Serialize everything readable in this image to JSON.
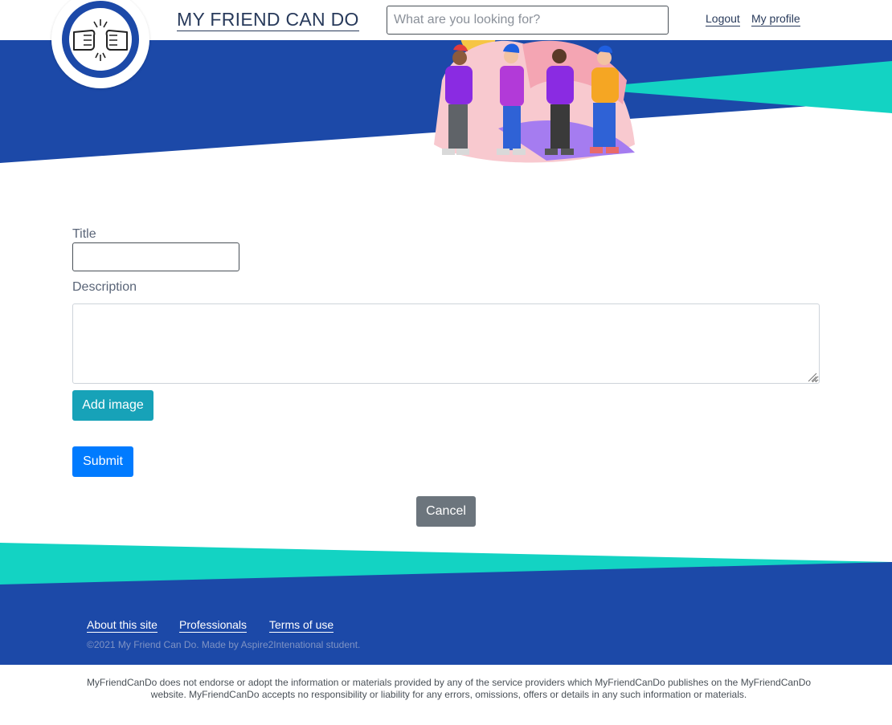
{
  "header": {
    "brand": "MY FRIEND CAN DO",
    "search_placeholder": "What are you looking for?",
    "nav": {
      "logout": "Logout",
      "profile": "My profile"
    }
  },
  "form": {
    "title_label": "Title",
    "title_value": "",
    "description_label": "Description",
    "description_value": "",
    "add_image_label": "Add image",
    "submit_label": "Submit",
    "cancel_label": "Cancel"
  },
  "footer": {
    "links": [
      "About this site",
      "Professionals",
      "Terms of use"
    ],
    "copyright": "©2021 My Friend Can Do. Made by Aspire2Intenational student.",
    "disclaimer": "MyFriendCanDo does not endorse or adopt the information or materials provided by any of the service providers which MyFriendCanDo publishes on the MyFriendCanDo website. MyFriendCanDo accepts no responsibility or liability for any errors, omissions, offers or details in any such information or materials."
  },
  "colors": {
    "brand_blue": "#1c49a8",
    "teal": "#13d3c3",
    "info": "#17a2b8",
    "primary": "#007bff",
    "secondary": "#6c757d"
  },
  "icons": {
    "logo": "fist-bump-icon",
    "resize": "resize-grip-icon"
  }
}
